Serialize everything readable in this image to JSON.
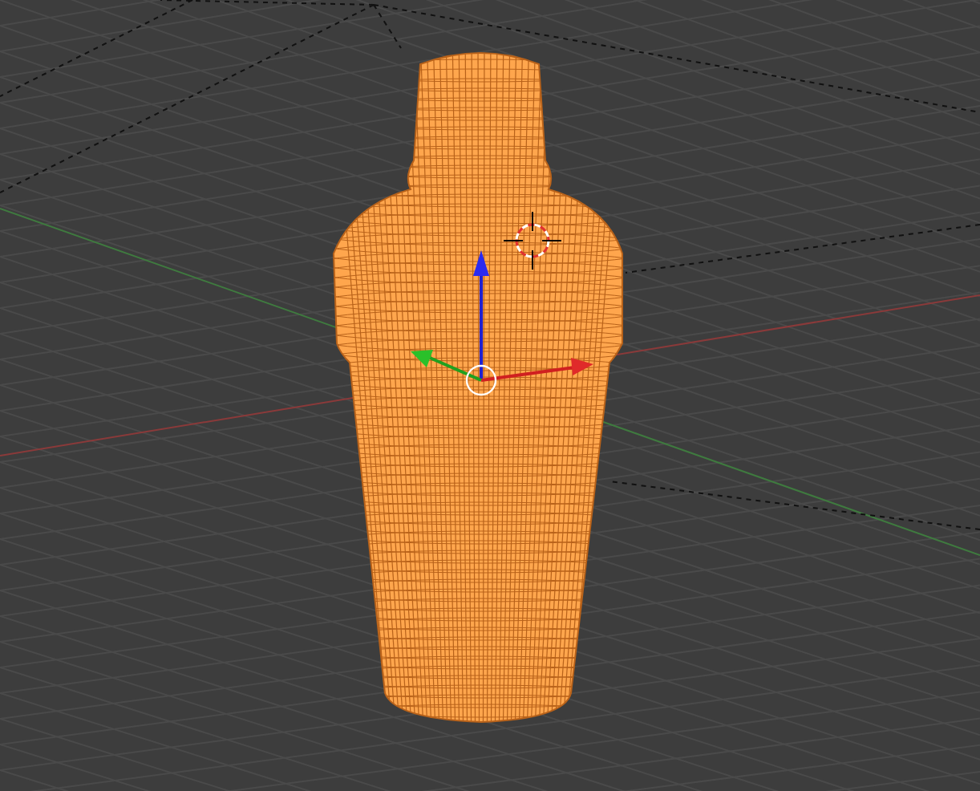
{
  "viewport": {
    "mesh": {
      "selected": true
    },
    "gizmo": {
      "on": true
    }
  }
}
